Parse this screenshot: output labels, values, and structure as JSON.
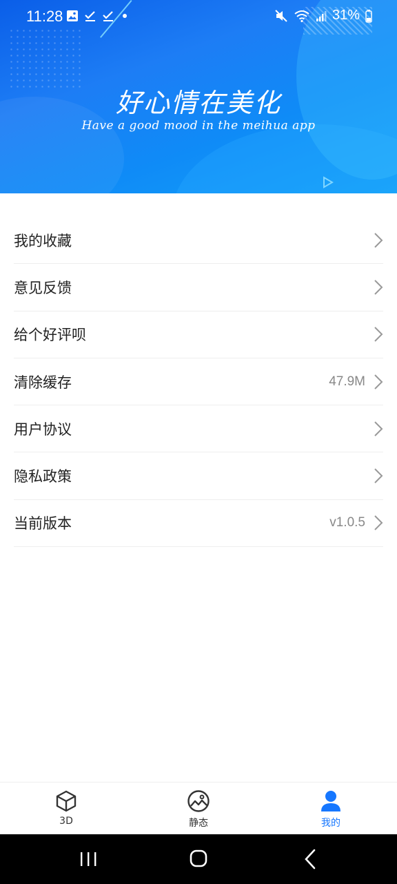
{
  "status_bar": {
    "time": "11:28",
    "battery": "31%"
  },
  "banner": {
    "title": "好心情在美化",
    "subtitle": "Have a good mood in the meihua  app"
  },
  "menu": {
    "items": [
      {
        "label": "我的收藏",
        "value": ""
      },
      {
        "label": "意见反馈",
        "value": ""
      },
      {
        "label": "给个好评呗",
        "value": ""
      },
      {
        "label": "清除缓存",
        "value": "47.9M"
      },
      {
        "label": "用户协议",
        "value": ""
      },
      {
        "label": "隐私政策",
        "value": ""
      },
      {
        "label": "当前版本",
        "value": "v1.0.5"
      }
    ]
  },
  "tabs": [
    {
      "label": "3D",
      "icon": "cube-icon",
      "active": false
    },
    {
      "label": "静态",
      "icon": "image-icon",
      "active": false
    },
    {
      "label": "我的",
      "icon": "person-icon",
      "active": true
    }
  ],
  "colors": {
    "accent": "#1677ff",
    "banner_start": "#0a5ee8",
    "banner_end": "#14a2f8"
  }
}
